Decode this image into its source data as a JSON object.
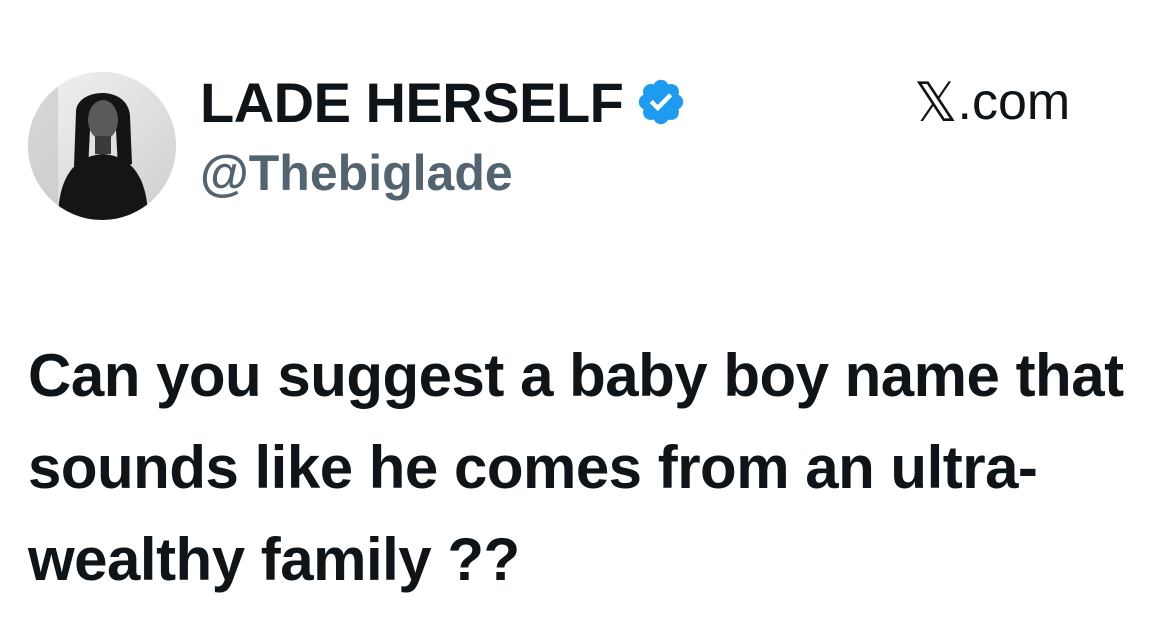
{
  "author": {
    "display_name": "LADE HERSELF",
    "handle": "@Thebiglade",
    "verified": true,
    "verified_color": "#1d9bf0",
    "avatar_icon": "profile-photo"
  },
  "brand": {
    "x_glyph": "𝕏",
    "suffix": ".com"
  },
  "tweet": {
    "text": "Can you suggest a baby boy name that sounds like he comes from an ultra-wealthy family ??"
  }
}
